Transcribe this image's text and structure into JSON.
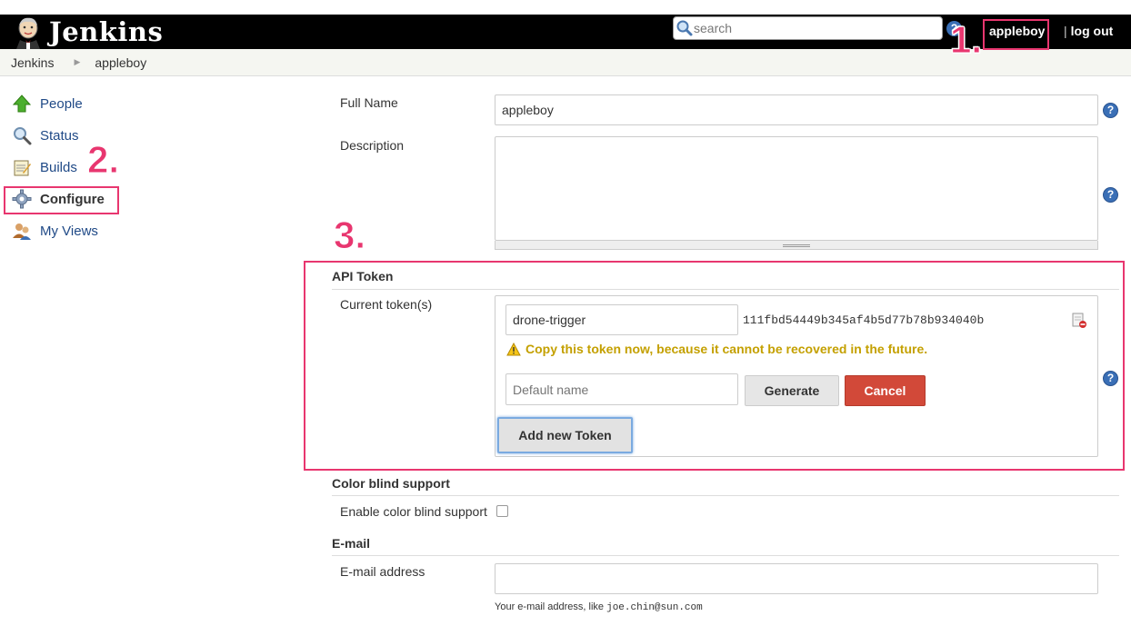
{
  "header": {
    "logo_text": "Jenkins",
    "search_placeholder": "search",
    "help_glyph": "?",
    "user_name": "appleboy",
    "logout_sep": "|",
    "logout_label": "log out"
  },
  "breadcrumb": {
    "items": [
      "Jenkins",
      "appleboy"
    ]
  },
  "sidebar": {
    "items": [
      {
        "label": "People",
        "icon": "arrow-up-icon"
      },
      {
        "label": "Status",
        "icon": "magnifier-icon"
      },
      {
        "label": "Builds",
        "icon": "notepad-icon"
      },
      {
        "label": "Configure",
        "icon": "gear-icon"
      },
      {
        "label": "My Views",
        "icon": "users-icon"
      }
    ]
  },
  "annotations": {
    "one": "1.",
    "two": "2.",
    "three": "3."
  },
  "form": {
    "full_name_label": "Full Name",
    "full_name_value": "appleboy",
    "description_label": "Description",
    "description_value": "",
    "api_token": {
      "section_title": "API Token",
      "current_label": "Current token(s)",
      "token_name": "drone-trigger",
      "token_value": "111fbd54449b345af4b5d77b78b934040b",
      "warning": "Copy this token now, because it cannot be recovered in the future.",
      "new_name_placeholder": "Default name",
      "generate_label": "Generate",
      "cancel_label": "Cancel",
      "add_label": "Add new Token"
    },
    "color_blind": {
      "section_title": "Color blind support",
      "label": "Enable color blind support",
      "checked": false
    },
    "email": {
      "section_title": "E-mail",
      "label": "E-mail address",
      "value": "",
      "hint_prefix": "Your e-mail address, like ",
      "hint_example": "joe.chin@sun.com"
    }
  },
  "colors": {
    "annotation": "#e8366f",
    "link": "#204a87",
    "cancel": "#d24939",
    "warning": "#c4a000"
  }
}
